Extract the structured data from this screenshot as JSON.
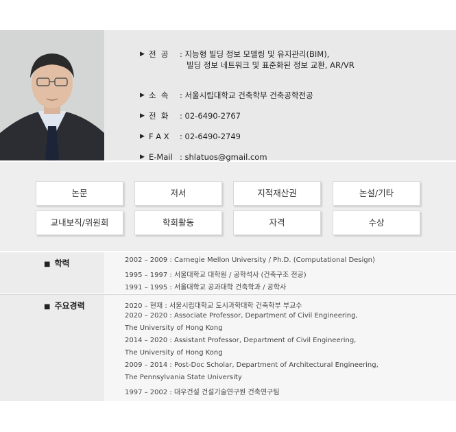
{
  "profile": {
    "rows": [
      {
        "label": "전  공",
        "lines": [
          "지능형 빌딩 정보 모델링 및 유지관리(BIM),",
          "빌딩 정보 네트워크 및 표준화된 정보 교환, AR/VR"
        ]
      },
      {
        "label": "소  속",
        "lines": [
          "서울시립대학교 건축학부 건축공학전공"
        ]
      },
      {
        "label": "전  화",
        "lines": [
          "02-6490-2767"
        ]
      },
      {
        "label": "F A X",
        "lines": [
          "02-6490-2749"
        ]
      },
      {
        "label": "E-Mail",
        "lines": [
          "shlatuos@gmail.com"
        ]
      }
    ],
    "bullet": "▶",
    "colon": ":"
  },
  "nav_buttons": [
    "논문",
    "저서",
    "지적재산권",
    "논설/기타",
    "교내보직/위원회",
    "학회활동",
    "자격",
    "수상"
  ],
  "sections": [
    {
      "title": "학력",
      "lines": [
        "2002 – 2009 : Carnegie Mellon University / Ph.D. (Computational Design)",
        "1995 – 1997 : 서울대학교 대학원 / 공학석사 (건축구조 전공)",
        "1991 – 1995 : 서울대학교 공과대학 건축학과 / 공학사"
      ]
    },
    {
      "title": "주요경력",
      "lines": [
        "2020 – 현재 : 서울시립대학교 도시과학대학 건축학부 부교수",
        "2020 – 2020 : Associate Professor, Department of Civil Engineering,",
        "The University of Hong Kong",
        "2014 – 2020 : Assistant Professor, Department of Civil Engineering,",
        "The University of Hong Kong",
        "2009 – 2014 : Post-Doc Scholar, Department of Architectural Engineering,",
        "The Pennsylvania State University",
        "1997 – 2002 : 대우건설 건설기술연구원 건축연구팀"
      ]
    }
  ],
  "section_marker": "■"
}
